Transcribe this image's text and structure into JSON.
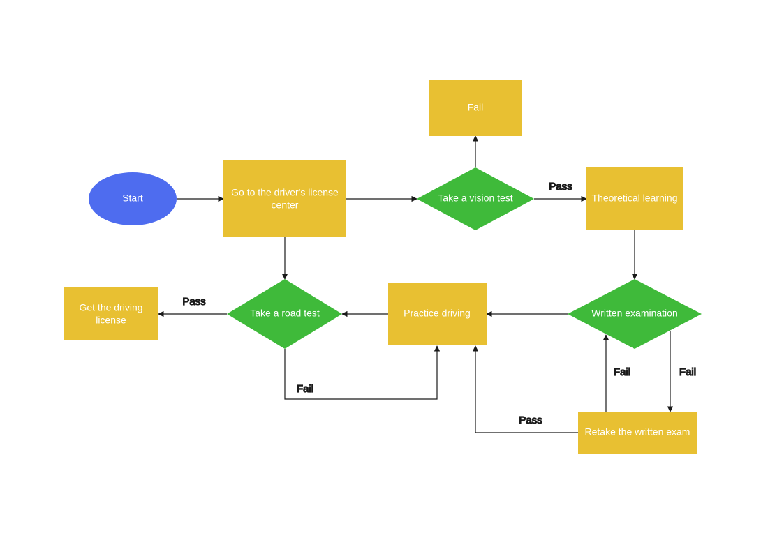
{
  "colors": {
    "ellipse": "#4e6cef",
    "rect": "#e8c032",
    "diamond": "#3fba3a",
    "edge": "#1a1a1a",
    "bg": "#ffffff"
  },
  "nodes": {
    "start": {
      "label": "Start"
    },
    "go_center": {
      "label1": "Go to the driver's license",
      "label2": "center"
    },
    "vision_test": {
      "label": "Take a vision test"
    },
    "fail_top": {
      "label": "Fail"
    },
    "theoretical": {
      "label": "Theoretical learning"
    },
    "written_exam": {
      "label": "Written examination"
    },
    "practice": {
      "label": "Practice driving"
    },
    "road_test": {
      "label": "Take a road test"
    },
    "get_license": {
      "label1": "Get the driving",
      "label2": "license"
    },
    "retake": {
      "label": "Retake the written exam"
    }
  },
  "edges": {
    "vision_pass": {
      "label": "Pass"
    },
    "written_fail_down": {
      "label": "Fail"
    },
    "retake_fail_up": {
      "label": "Fail"
    },
    "retake_pass": {
      "label": "Pass"
    },
    "road_pass": {
      "label": "Pass"
    },
    "road_fail": {
      "label": "Fail"
    }
  }
}
